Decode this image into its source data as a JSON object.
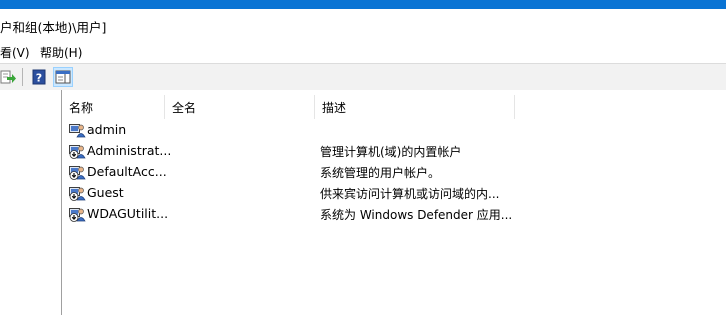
{
  "window": {
    "title": "户和组(本地)\\用户]"
  },
  "menubar": {
    "items": [
      {
        "label": "看(V)"
      },
      {
        "label": "帮助(H)"
      }
    ]
  },
  "toolbar": {
    "icons": [
      "export-list-icon",
      "help-icon",
      "show-action-pane-icon"
    ]
  },
  "list": {
    "columns": [
      {
        "label": "名称"
      },
      {
        "label": "全名"
      },
      {
        "label": "描述"
      }
    ],
    "rows": [
      {
        "name": "admin",
        "full_name": "",
        "description": "",
        "icon": "user-icon"
      },
      {
        "name": "Administrat...",
        "full_name": "",
        "description": "管理计算机(域)的内置帐户",
        "icon": "disabled-user-icon"
      },
      {
        "name": "DefaultAcc...",
        "full_name": "",
        "description": "系统管理的用户帐户。",
        "icon": "disabled-user-icon"
      },
      {
        "name": "Guest",
        "full_name": "",
        "description": "供来宾访问计算机或访问域的内...",
        "icon": "disabled-user-icon"
      },
      {
        "name": "WDAGUtilit...",
        "full_name": "",
        "description": "系统为 Windows Defender 应用...",
        "icon": "disabled-user-icon"
      }
    ]
  }
}
